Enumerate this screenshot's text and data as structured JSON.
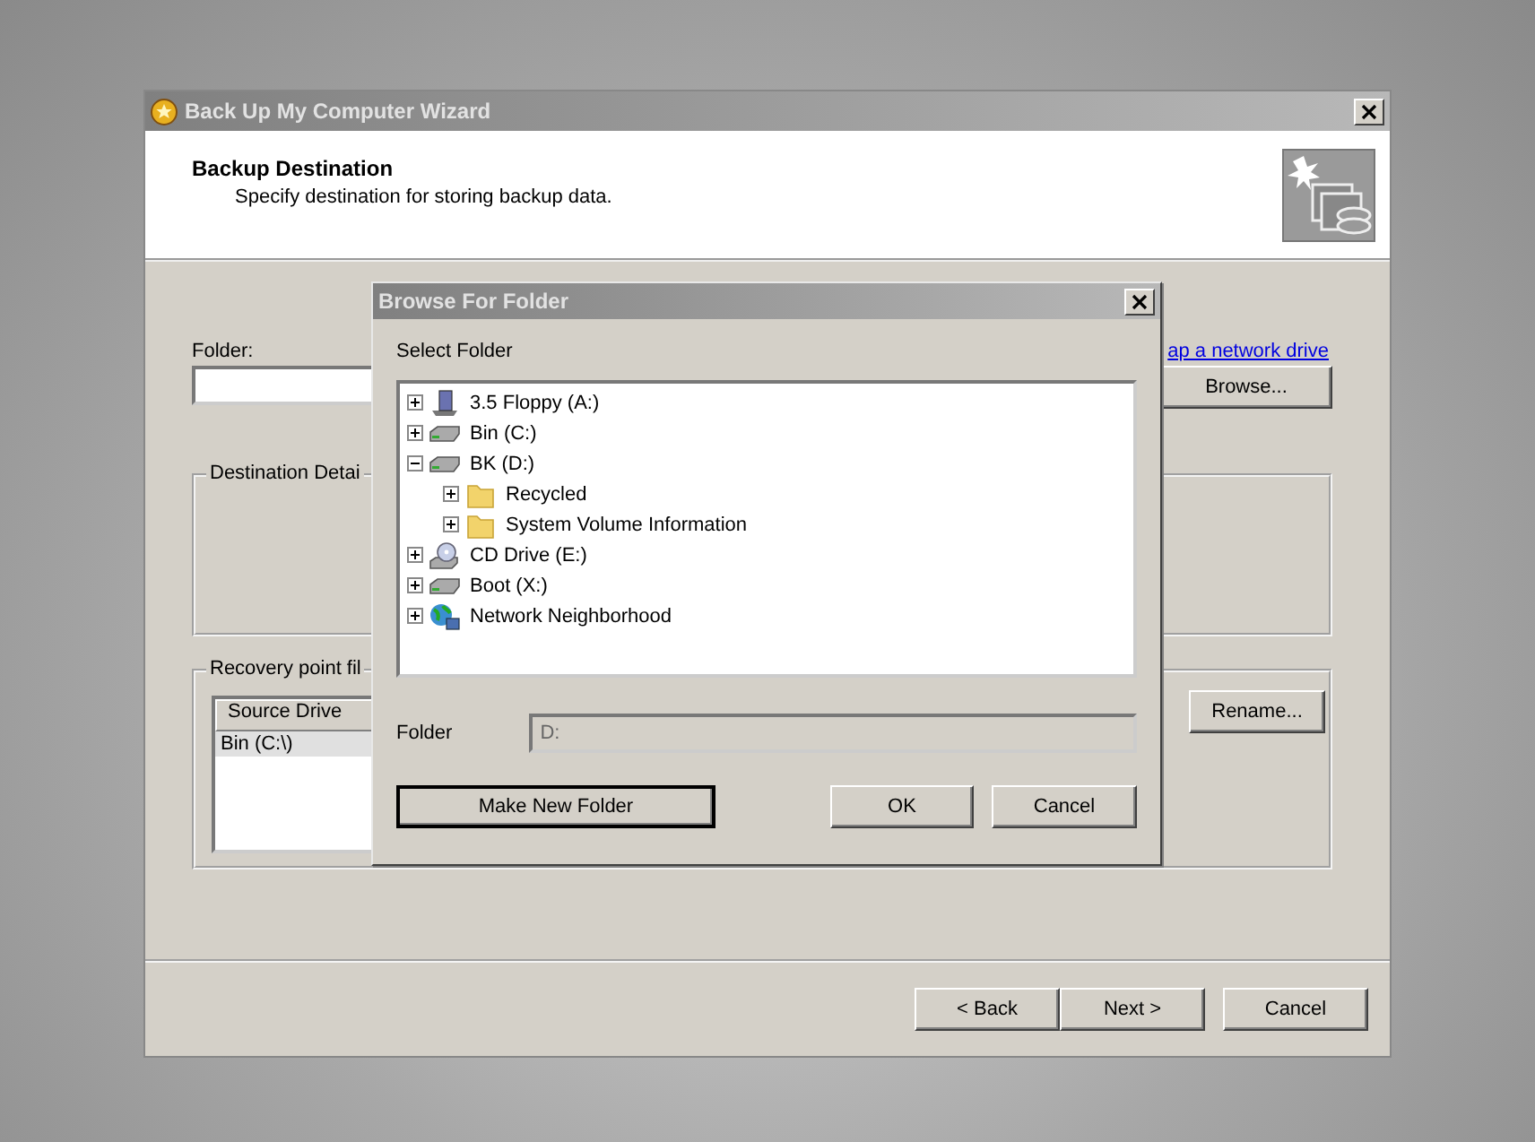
{
  "wizard": {
    "title": "Back Up My Computer Wizard",
    "header": {
      "title": "Backup Destination",
      "subtitle": "Specify destination for storing backup data."
    },
    "folder_label": "Folder:",
    "network_link": "ap a network drive",
    "browse_button": "Browse...",
    "destination_group": "Destination Detai",
    "recovery_group": "Recovery point fil",
    "recovery_list": {
      "columns": [
        "Source Drive"
      ],
      "rows": [
        {
          "cells": [
            "Bin (C:\\)"
          ],
          "selected": true
        }
      ]
    },
    "rename_button": "Rename...",
    "buttons": [
      "< Back",
      "Next >",
      "Cancel"
    ]
  },
  "dialog": {
    "title": "Browse For Folder",
    "prompt": "Select Folder",
    "tree": [
      {
        "label": "3.5 Floppy (A:)",
        "kind": "floppy",
        "expanded": false
      },
      {
        "label": "Bin (C:)",
        "kind": "drive",
        "expanded": false
      },
      {
        "label": "BK (D:)",
        "kind": "drive",
        "expanded": true,
        "children": [
          {
            "label": "Recycled",
            "kind": "folder",
            "expanded": false
          },
          {
            "label": "System Volume Information",
            "kind": "folder",
            "expanded": false
          }
        ]
      },
      {
        "label": "CD Drive (E:)",
        "kind": "cdrom",
        "expanded": false
      },
      {
        "label": "Boot (X:)",
        "kind": "drive",
        "expanded": false
      },
      {
        "label": "Network Neighborhood",
        "kind": "network",
        "expanded": false
      }
    ],
    "folder_label": "Folder",
    "folder_value": "D:",
    "make_folder_button": "Make New Folder",
    "ok_button": "OK",
    "cancel_button": "Cancel"
  }
}
